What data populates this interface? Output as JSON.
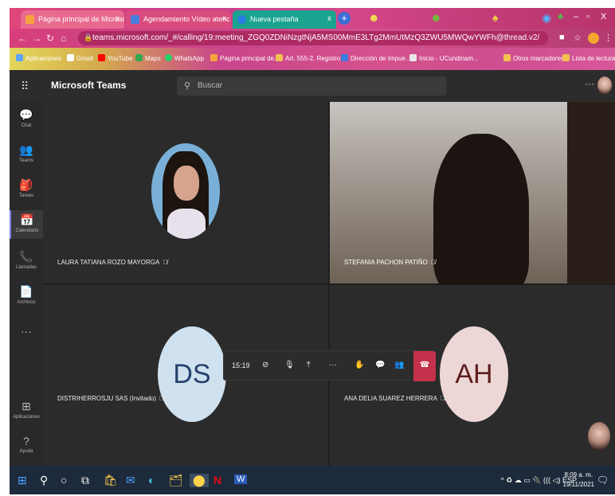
{
  "browser": {
    "tabs": [
      {
        "title": "Página principal de Microsoft O",
        "color": "#e86a8e"
      },
      {
        "title": "Agendamiento Vídeo atenc",
        "color": "#d94c7e"
      },
      {
        "title": "Nueva pestaña",
        "color": "#1aa38f"
      }
    ],
    "tab_close": "x",
    "new_tab": "+",
    "window_controls": {
      "minimize": "–",
      "restore": "▫",
      "close": "X"
    },
    "url": "teams.microsoft.com/_#/calling/19:meeting_ZGQ0ZDNiNzgtNjA5MS00MmE3LTg2MmUtMzQ3ZWU5MWQwYWFh@thread.v2/",
    "bookmarks": [
      "Aplicaciones",
      "Gmail",
      "YouTube",
      "Maps",
      "WhatsApp",
      "Página principal de...",
      "Art. 555-2. Registro...",
      "Dirección de Impue...",
      "Inicio - UCundinam...",
      "Otros marcadores",
      "Lista de lectura"
    ]
  },
  "teams": {
    "app_name": "Microsoft Teams",
    "search_placeholder": "Buscar",
    "more": "···",
    "rail": [
      {
        "label": "Chat",
        "icon": "chat-icon",
        "glyph": "💬"
      },
      {
        "label": "Teams",
        "icon": "teams-icon",
        "glyph": "👥"
      },
      {
        "label": "Tareas",
        "icon": "tasks-icon",
        "glyph": "🎒"
      },
      {
        "label": "Calendario",
        "icon": "calendar-icon",
        "glyph": "📅"
      },
      {
        "label": "Llamadas",
        "icon": "phone-icon",
        "glyph": "📞"
      },
      {
        "label": "Archivos",
        "icon": "files-icon",
        "glyph": "📄"
      }
    ],
    "rail_more": "···",
    "rail_bottom": [
      {
        "label": "Aplicaciones",
        "icon": "apps-icon",
        "glyph": "⊞"
      },
      {
        "label": "Ayuda",
        "icon": "help-icon",
        "glyph": "?"
      }
    ],
    "participants": [
      {
        "name": "LAURA TATIANA ROZO MAYORGA",
        "muted": true
      },
      {
        "name": "STEFANIA PACHON PATIÑO",
        "muted": true
      },
      {
        "name": "DISTRIHERROSJU SAS (Invitado)",
        "muted": true,
        "initials": "DS"
      },
      {
        "name": "ANA DELIA SUAREZ HERRERA",
        "muted": true,
        "initials": "AH"
      }
    ],
    "call_controls": {
      "duration": "15:19",
      "camera_off": "⊘",
      "mic_off": "🎙",
      "share": "⤒",
      "more": "···",
      "raise_hand": "✋",
      "chat": "💬",
      "people": "👥",
      "hang_up": "☎"
    },
    "accent": "#7b83eb",
    "hangup_color": "#c4314b"
  },
  "taskbar": {
    "time": "8:09 a. m.",
    "date": "19/11/2021",
    "language": "ESP",
    "tray": "^ ♻ ☁ ▭ 🔌 ((( ◁)",
    "apps": [
      "⊞",
      "⚲",
      "○",
      "⧉",
      "🛍",
      "✉",
      "◐",
      "🗂",
      "⬤",
      "N",
      "W"
    ]
  }
}
